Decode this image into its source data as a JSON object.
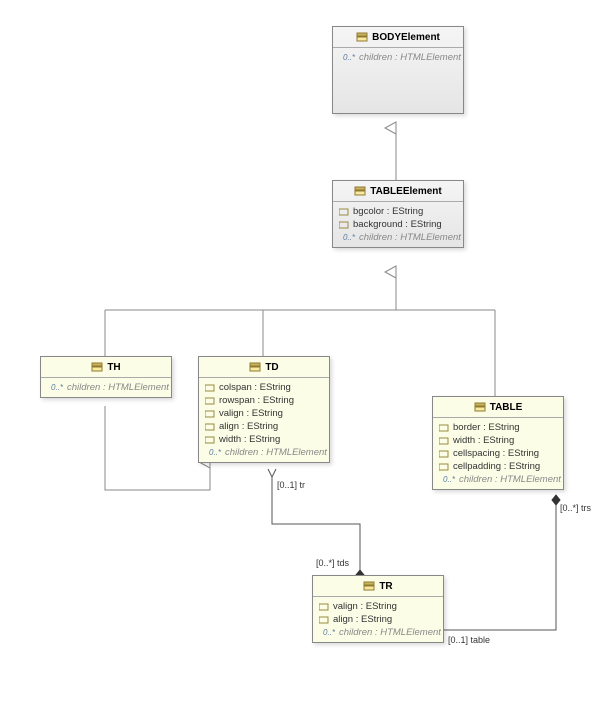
{
  "classes": {
    "body": {
      "name": "BODYElement",
      "refs": [
        {
          "text": "children : HTMLElement",
          "mult": "0..*"
        }
      ]
    },
    "tableelement": {
      "name": "TABLEElement",
      "attrs": [
        {
          "text": "bgcolor : EString"
        },
        {
          "text": "background : EString"
        }
      ],
      "refs": [
        {
          "text": "children : HTMLElement",
          "mult": "0..*"
        }
      ]
    },
    "th": {
      "name": "TH",
      "refs": [
        {
          "text": "children : HTMLElement",
          "mult": "0..*"
        }
      ]
    },
    "td": {
      "name": "TD",
      "attrs": [
        {
          "text": "colspan : EString"
        },
        {
          "text": "rowspan : EString"
        },
        {
          "text": "valign : EString"
        },
        {
          "text": "align : EString"
        },
        {
          "text": "width : EString"
        }
      ],
      "refs": [
        {
          "text": "children : HTMLElement",
          "mult": "0..*"
        }
      ]
    },
    "table": {
      "name": "TABLE",
      "attrs": [
        {
          "text": "border : EString"
        },
        {
          "text": "width : EString"
        },
        {
          "text": "cellspacing : EString"
        },
        {
          "text": "cellpadding : EString"
        }
      ],
      "refs": [
        {
          "text": "children : HTMLElement",
          "mult": "0..*"
        }
      ]
    },
    "tr": {
      "name": "TR",
      "attrs": [
        {
          "text": "valign : EString"
        },
        {
          "text": "align : EString"
        }
      ],
      "refs": [
        {
          "text": "children : HTMLElement",
          "mult": "0..*"
        }
      ]
    }
  },
  "edgeLabels": {
    "trToTd_end": "[0..1] tr",
    "tdToTr_end": "[0..*] tds",
    "tableToTr_end": "[0..1] table",
    "trToTable_end": "[0..*] trs"
  }
}
